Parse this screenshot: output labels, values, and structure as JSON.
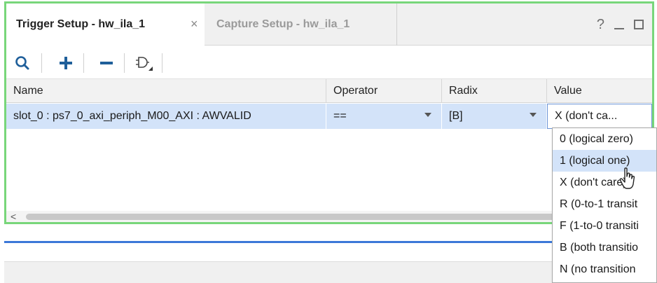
{
  "tabs": [
    {
      "label": "Trigger Setup - hw_ila_1",
      "active": true,
      "close_glyph": "×"
    },
    {
      "label": "Capture Setup - hw_ila_1",
      "active": false
    }
  ],
  "window_controls": {
    "help": "?"
  },
  "toolbar": {
    "icons": [
      "search-icon",
      "add-icon",
      "remove-icon",
      "trigger-condition-icon"
    ]
  },
  "table": {
    "columns": [
      "Name",
      "Operator",
      "Radix",
      "Value"
    ],
    "rows": [
      {
        "name": "slot_0 : ps7_0_axi_periph_M00_AXI : AWVALID",
        "operator": "==",
        "radix": "[B]",
        "value": "X (don't ca..."
      }
    ]
  },
  "value_dropdown": {
    "options": [
      "0 (logical zero)",
      "1 (logical one)",
      "X (don't care)",
      "R (0-to-1 transit",
      "F (1-to-0 transiti",
      "B (both transitio",
      "N (no transition"
    ],
    "hovered_index": 1
  },
  "scrollbar": {
    "left_arrow": "<"
  },
  "colors": {
    "panel_border": "#78d67a",
    "selected_row": "#d3e3f9",
    "lower_panel_accent": "#3c78d8"
  }
}
